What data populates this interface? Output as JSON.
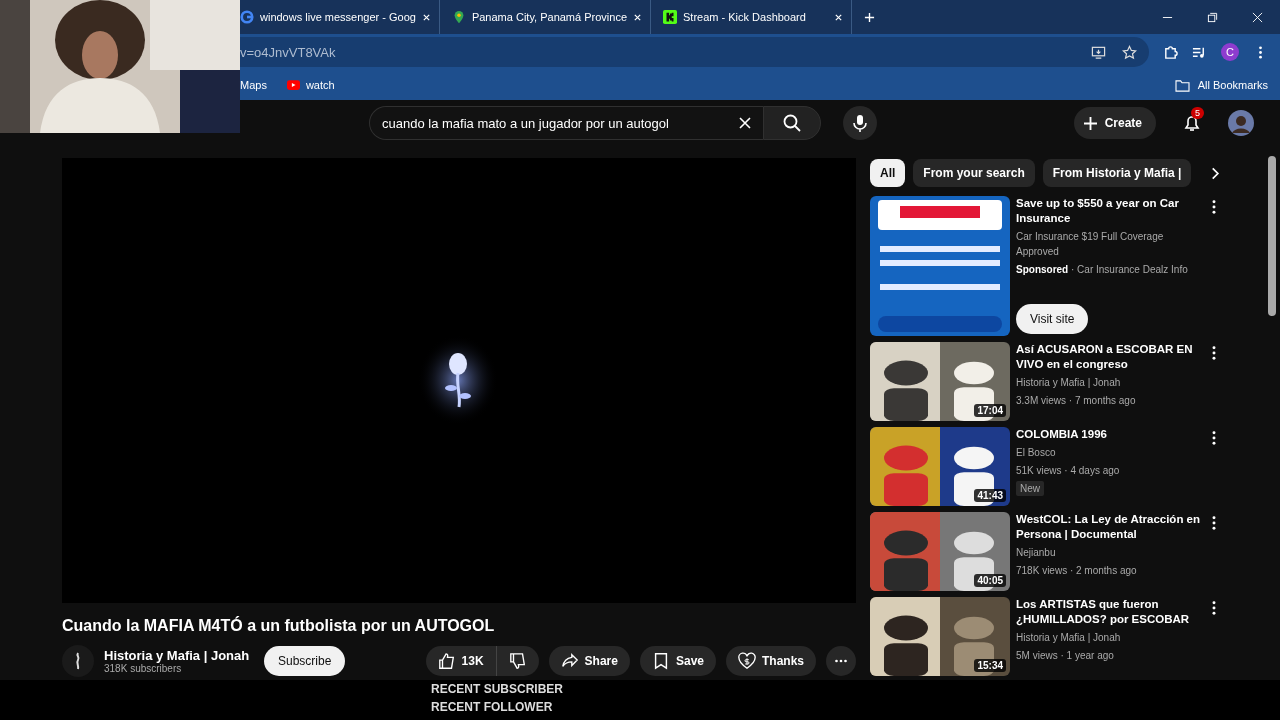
{
  "browser": {
    "tabs": [
      {
        "title": "windows live messenger - Goog",
        "selected": false
      },
      {
        "title": "Panama City, Panamá Province",
        "selected": false
      },
      {
        "title": "Stream - Kick Dashboard",
        "selected": false
      }
    ],
    "address": "v=o4JnvVT8VAk",
    "profile_initial": "C",
    "bookmarks": [
      {
        "label": "Maps"
      },
      {
        "label": "watch"
      }
    ],
    "all_bookmarks": "All Bookmarks"
  },
  "header": {
    "search_value": "cuando la mafia mato a un jugador por un autogol",
    "create": "Create",
    "notifications": "5"
  },
  "video": {
    "title": "Cuando la MAFIA M4TÓ a un futbolista por un AUTOGOL",
    "channel": "Historia y Mafia | Jonah",
    "subscribers": "318K subscribers",
    "subscribe": "Subscribe",
    "likes": "13K",
    "share": "Share",
    "save": "Save",
    "thanks": "Thanks"
  },
  "chips": [
    {
      "label": "All",
      "selected": true
    },
    {
      "label": "From your search",
      "selected": false
    },
    {
      "label": "From Historia y Mafia |",
      "selected": false
    }
  ],
  "related": [
    {
      "kind": "ad",
      "title": "Save up to $550 a year on Car Insurance",
      "description": "Car Insurance $19 Full Coverage Approved",
      "sponsor": "**Sponsored** · Car Insurance Dealz Info",
      "action": "Visit site"
    },
    {
      "kind": "video",
      "title": "Así ACUSARON a ESCOBAR EN VIVO en el congreso",
      "channel": "Historia y Mafia | Jonah",
      "meta": "3.3M views · 7 months ago",
      "duration": "17:04"
    },
    {
      "kind": "video",
      "title": "COLOMBIA 1996",
      "channel": "El Bosco",
      "meta": "51K views · 4 days ago",
      "duration": "41:43",
      "badge": "New"
    },
    {
      "kind": "video",
      "title": "WestCOL: La Ley de Atracción en Persona | Documental",
      "channel": "Nejianbu",
      "meta": "718K views · 2 months ago",
      "duration": "40:05"
    },
    {
      "kind": "video",
      "title": "Los ARTISTAS que fueron ¿HUMILLADOS? por ESCOBAR",
      "channel": "Historia y Mafia | Jonah",
      "meta": "5M views · 1 year ago",
      "duration": "15:34"
    }
  ],
  "overlay": {
    "lines": [
      "RECENT SUBSCRIBER",
      "RECENT FOLLOWER"
    ]
  }
}
